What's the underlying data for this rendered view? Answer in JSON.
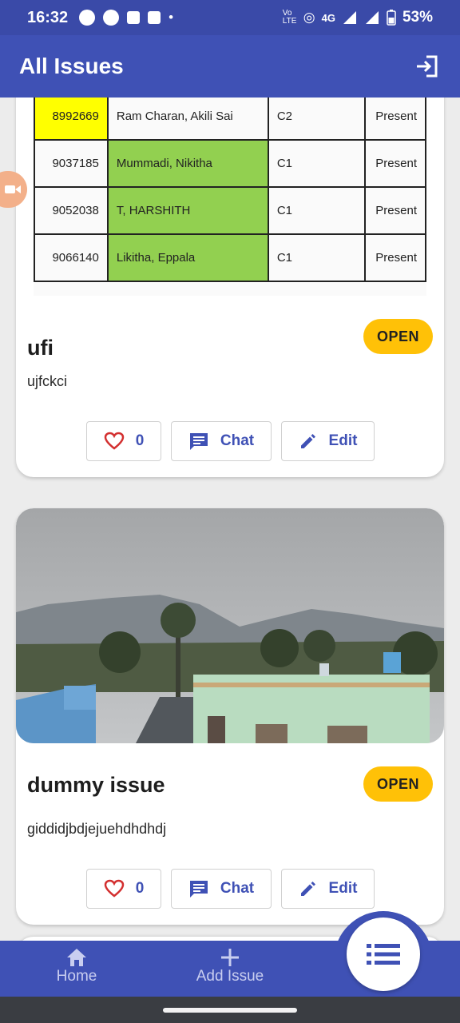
{
  "status_bar": {
    "time": "16:32",
    "network": "4G",
    "volte": "Vo LTE",
    "battery": "53%"
  },
  "app_bar": {
    "title": "All Issues",
    "logout_icon": "logout-icon"
  },
  "issues": [
    {
      "title": "ufi",
      "status": "OPEN",
      "description": "ujfckci",
      "likes": "0",
      "chat_label": "Chat",
      "edit_label": "Edit",
      "attachment_rows": [
        {
          "id": "",
          "name": "",
          "group": "",
          "status": ""
        },
        {
          "id": "8992669",
          "name": "Ram Charan, Akili Sai",
          "group": "C2",
          "status": "Present"
        },
        {
          "id": "9037185",
          "name": "Mummadi, Nikitha",
          "group": "C1",
          "status": "Present"
        },
        {
          "id": "9052038",
          "name": "T, HARSHITH",
          "group": "C1",
          "status": "Present"
        },
        {
          "id": "9066140",
          "name": "Likitha, Eppala",
          "group": "C1",
          "status": "Present"
        }
      ]
    },
    {
      "title": "dummy issue",
      "status": "OPEN",
      "description": "giddidjbdjejuehdhdhdj",
      "likes": "0",
      "chat_label": "Chat",
      "edit_label": "Edit"
    }
  ],
  "bottom_nav": {
    "home_label": "Home",
    "add_label": "Add Issue"
  },
  "colors": {
    "primary": "#3f51b5",
    "badge": "#ffc107",
    "sheet_green": "#92d050",
    "sheet_yellow": "#ffff00"
  }
}
